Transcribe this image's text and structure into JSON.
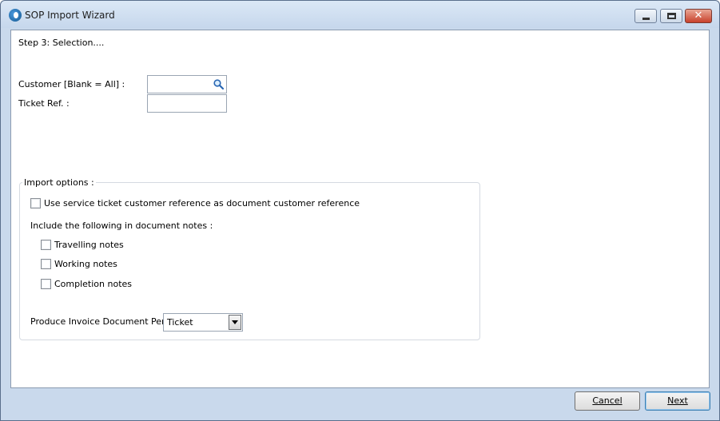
{
  "window": {
    "title": "SOP Import Wizard",
    "minimize_glyph": "",
    "maximize_glyph": "",
    "close_glyph": "✕"
  },
  "step": {
    "label": "Step 3: Selection...."
  },
  "customer": {
    "label": "Customer [Blank = All] :",
    "value": ""
  },
  "ticket_ref": {
    "label": "Ticket Ref. :",
    "value": ""
  },
  "import_options": {
    "legend": "Import options :",
    "use_service_ticket_label": "Use service ticket customer reference as document customer reference",
    "use_service_ticket_checked": false,
    "include_notes_label": "Include the following in document notes :",
    "notes": [
      {
        "label": "Travelling notes",
        "checked": false
      },
      {
        "label": "Working notes",
        "checked": false
      },
      {
        "label": "Completion notes",
        "checked": false
      }
    ],
    "produce_invoice_label": "Produce Invoice Document Per :",
    "produce_invoice_value": "Ticket"
  },
  "buttons": {
    "cancel": "Cancel",
    "next": "Next"
  }
}
